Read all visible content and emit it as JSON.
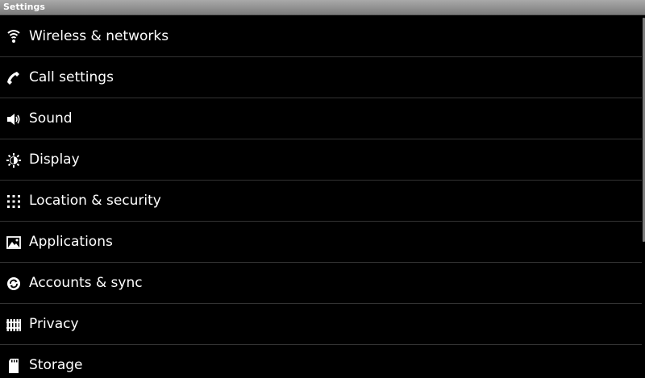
{
  "window": {
    "title": "Settings"
  },
  "settings": {
    "items": [
      {
        "label": "Wireless & networks",
        "icon": "wifi-icon"
      },
      {
        "label": "Call settings",
        "icon": "phone-icon"
      },
      {
        "label": "Sound",
        "icon": "speaker-icon"
      },
      {
        "label": "Display",
        "icon": "brightness-icon"
      },
      {
        "label": "Location & security",
        "icon": "grid-lock-icon"
      },
      {
        "label": "Applications",
        "icon": "applications-icon"
      },
      {
        "label": "Accounts & sync",
        "icon": "sync-icon"
      },
      {
        "label": "Privacy",
        "icon": "privacy-icon"
      },
      {
        "label": "Storage",
        "icon": "sdcard-icon"
      }
    ]
  },
  "colors": {
    "background": "#000000",
    "text": "#ffffff",
    "divider": "#333333",
    "title_bar": "#8f8f8f"
  }
}
